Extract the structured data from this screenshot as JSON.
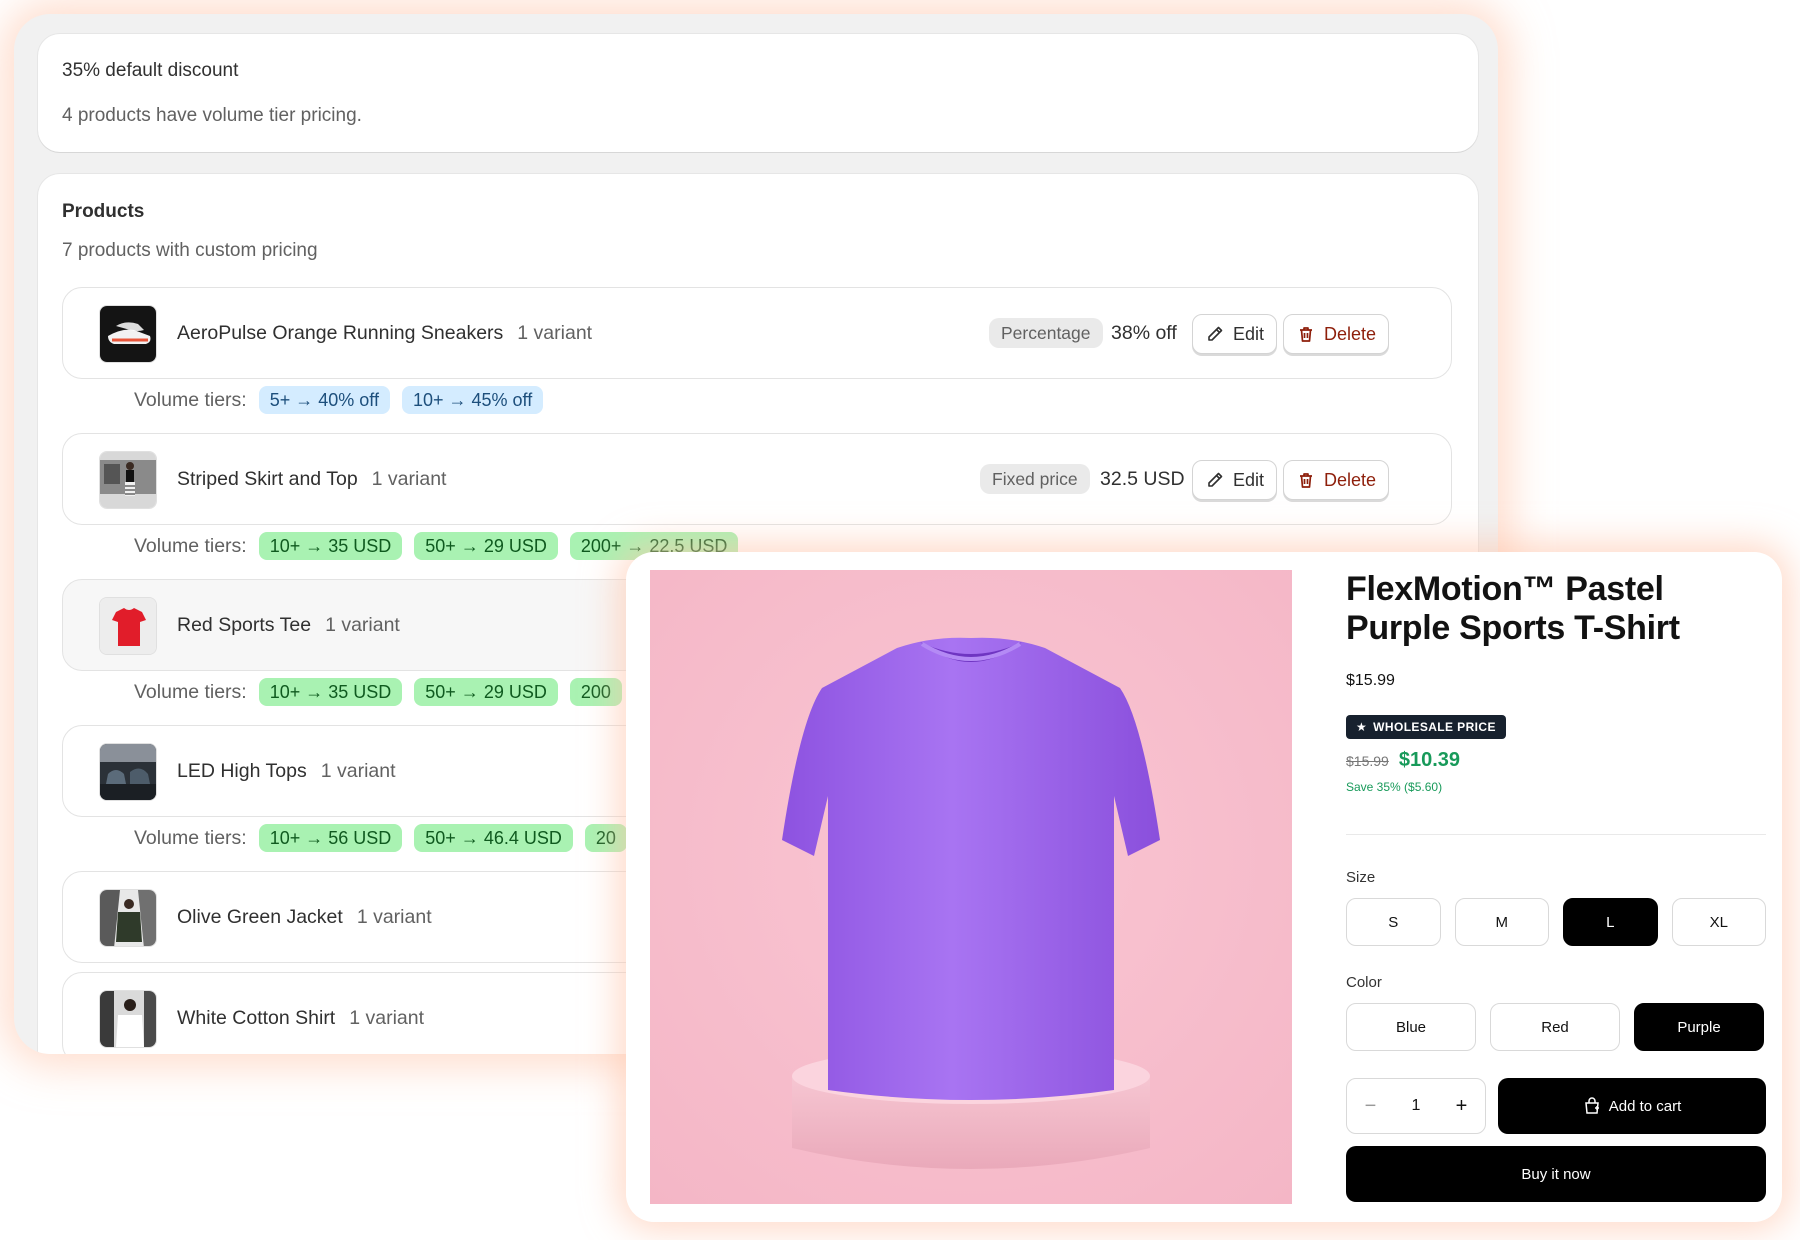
{
  "discount": {
    "title": "35% default discount",
    "subtitle": "4 products have volume tier pricing."
  },
  "products": {
    "title": "Products",
    "subtitle": "7 products with custom pricing",
    "tiers_label": "Volume tiers:",
    "edit_label": "Edit",
    "delete_label": "Delete",
    "items": [
      {
        "name": "AeroPulse Orange Running Sneakers",
        "variants": "1 variant",
        "type": "Percentage",
        "value": "38% off",
        "tiers": [
          "5+ → 40% off",
          "10+ → 45% off"
        ],
        "tier_color": "#d4ecff"
      },
      {
        "name": "Striped Skirt and Top",
        "variants": "1 variant",
        "type": "Fixed price",
        "value": "32.5 USD",
        "tiers": [
          "10+ → 35 USD",
          "50+ → 29 USD",
          "200+ → 22.5 USD"
        ],
        "tier_color": "#a9f2b2"
      },
      {
        "name": "Red Sports Tee",
        "variants": "1 variant",
        "tiers": [
          "10+ → 35 USD",
          "50+ → 29 USD",
          "200"
        ]
      },
      {
        "name": "LED High Tops",
        "variants": "1 variant",
        "tiers": [
          "10+ → 56 USD",
          "50+ → 46.4 USD",
          "20"
        ]
      },
      {
        "name": "Olive Green Jacket",
        "variants": "1 variant"
      },
      {
        "name": "White Cotton Shirt",
        "variants": "1 variant"
      }
    ]
  },
  "pdp": {
    "title": "FlexMotion™ Pastel Purple Sports T-Shirt",
    "price": "$15.99",
    "badge": "WHOLESALE PRICE",
    "old_price": "$15.99",
    "new_price": "$10.39",
    "save": "Save 35% ($5.60)",
    "size_label": "Size",
    "sizes": [
      "S",
      "M",
      "L",
      "XL"
    ],
    "selected_size": "L",
    "color_label": "Color",
    "colors": [
      "Blue",
      "Red",
      "Purple"
    ],
    "selected_color": "Purple",
    "quantity": "1",
    "add_to_cart": "Add to cart",
    "buy_now": "Buy it now",
    "accent_green": "#189a5a"
  }
}
